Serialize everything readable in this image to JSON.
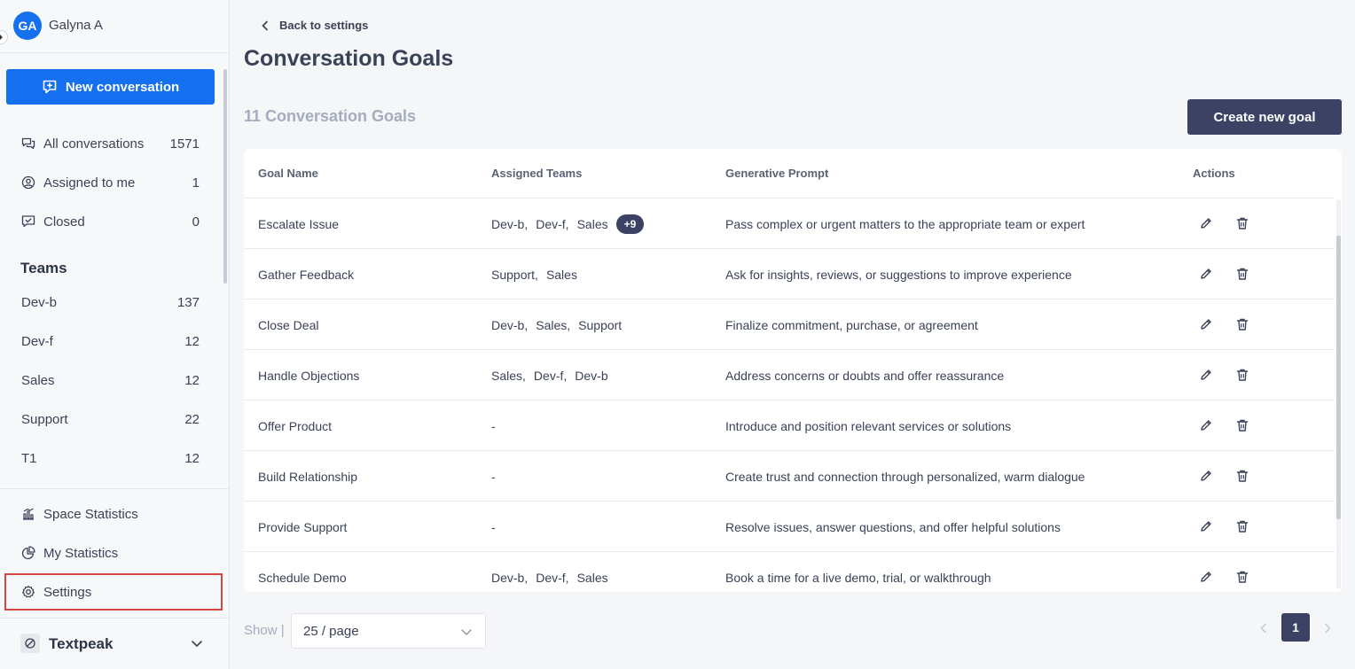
{
  "user": {
    "initials": "GA",
    "name": "Galyna A"
  },
  "sidebar": {
    "new_conversation_label": "New conversation",
    "nav": [
      {
        "label": "All conversations",
        "count": "1571",
        "icon": "chat-bubbles-icon"
      },
      {
        "label": "Assigned to me",
        "count": "1",
        "icon": "user-circle-icon"
      },
      {
        "label": "Closed",
        "count": "0",
        "icon": "chat-check-icon"
      }
    ],
    "teams_title": "Teams",
    "teams": [
      {
        "label": "Dev-b",
        "count": "137"
      },
      {
        "label": "Dev-f",
        "count": "12"
      },
      {
        "label": "Sales",
        "count": "12"
      },
      {
        "label": "Support",
        "count": "22"
      },
      {
        "label": "T1",
        "count": "12"
      }
    ],
    "bottom": [
      {
        "label": "Space Statistics",
        "icon": "bar-chart-icon"
      },
      {
        "label": "My Statistics",
        "icon": "pie-chart-icon"
      },
      {
        "label": "Settings",
        "icon": "gear-icon"
      }
    ],
    "workspace": {
      "name": "Textpeak"
    }
  },
  "header": {
    "back_label": "Back to settings",
    "title": "Conversation Goals",
    "goals_count_label": "11 Conversation Goals",
    "create_button_label": "Create new goal"
  },
  "table": {
    "columns": [
      "Goal Name",
      "Assigned Teams",
      "Generative Prompt",
      "Actions"
    ],
    "rows": [
      {
        "name": "Escalate Issue",
        "teams": [
          "Dev-b,",
          "Dev-f,",
          "Sales"
        ],
        "more": "+9",
        "prompt": "Pass complex or urgent matters to the appropriate team or expert"
      },
      {
        "name": "Gather Feedback",
        "teams": [
          "Support,",
          "Sales"
        ],
        "more": "",
        "prompt": "Ask for insights, reviews, or suggestions to improve experience"
      },
      {
        "name": "Close Deal",
        "teams": [
          "Dev-b,",
          "Sales,",
          "Support"
        ],
        "more": "",
        "prompt": "Finalize commitment, purchase, or agreement"
      },
      {
        "name": "Handle Objections",
        "teams": [
          "Sales,",
          "Dev-f,",
          "Dev-b"
        ],
        "more": "",
        "prompt": "Address concerns or doubts and offer reassurance"
      },
      {
        "name": "Offer Product",
        "teams": [
          "-"
        ],
        "more": "",
        "prompt": "Introduce and position relevant services or solutions"
      },
      {
        "name": "Build Relationship",
        "teams": [
          "-"
        ],
        "more": "",
        "prompt": "Create trust and connection through personalized, warm dialogue"
      },
      {
        "name": "Provide Support",
        "teams": [
          "-"
        ],
        "more": "",
        "prompt": "Resolve issues, answer questions, and offer helpful solutions"
      },
      {
        "name": "Schedule Demo",
        "teams": [
          "Dev-b,",
          "Dev-f,",
          "Sales"
        ],
        "more": "",
        "prompt": "Book a time for a live demo, trial, or walkthrough"
      }
    ]
  },
  "pagination": {
    "show_label": "Show |",
    "page_size": "25 / page",
    "current_page": "1"
  },
  "colors": {
    "primary": "#1570ef",
    "dark_button": "#3b4263",
    "highlight_border": "#e0443e"
  }
}
